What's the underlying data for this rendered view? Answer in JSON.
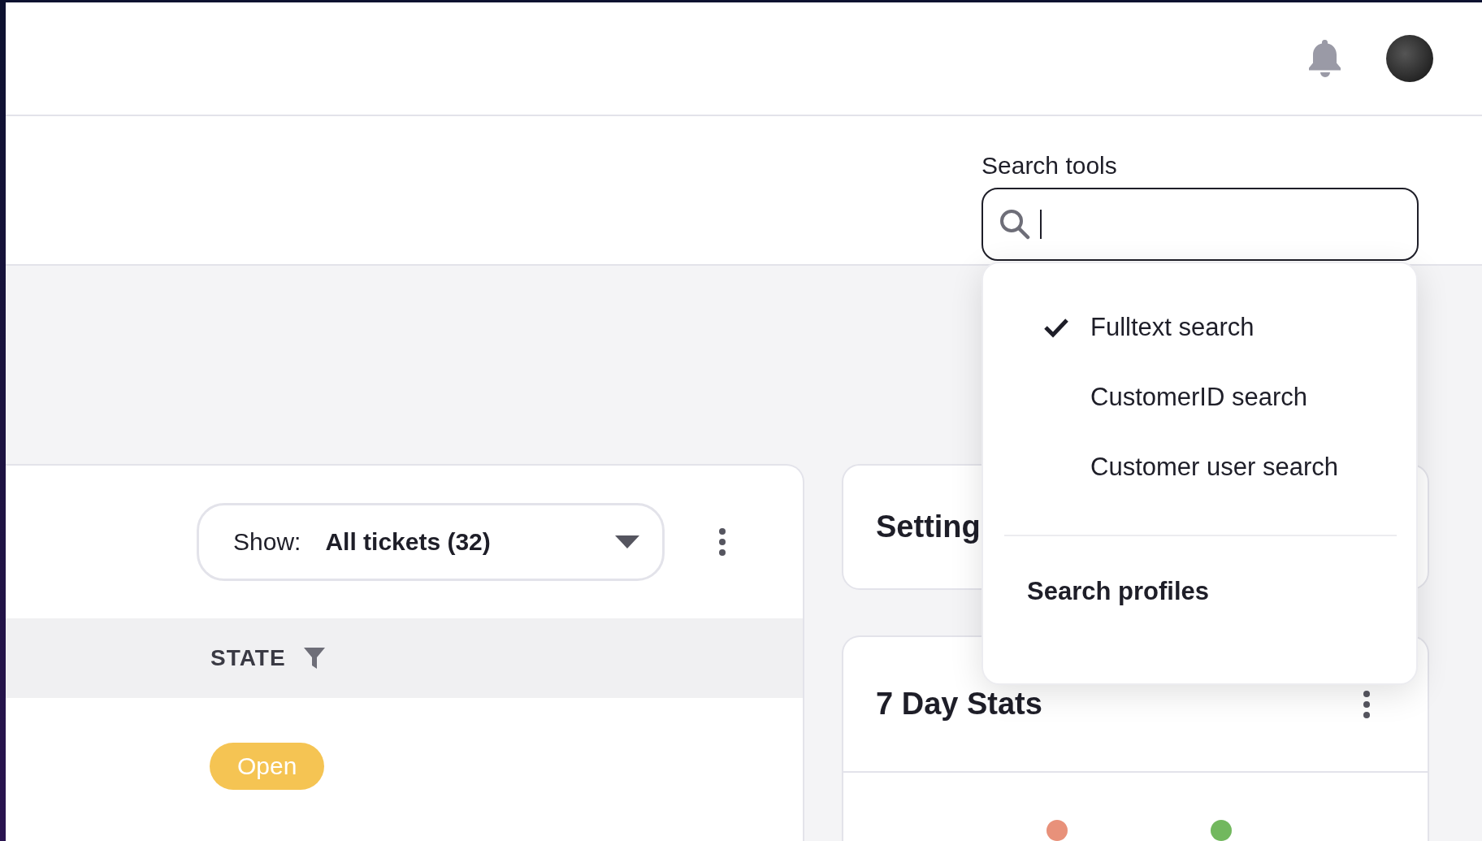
{
  "search": {
    "label": "Search tools",
    "menu": [
      {
        "label": "Fulltext search",
        "selected": true
      },
      {
        "label": "CustomerID search",
        "selected": false
      },
      {
        "label": "Customer user search",
        "selected": false
      }
    ],
    "profiles_label": "Search profiles"
  },
  "tickets": {
    "show_label": "Show:",
    "show_value": "All tickets (32)",
    "columns": [
      {
        "label": "STATE"
      }
    ],
    "rows": [
      {
        "state": "Open",
        "color": "#f5c453"
      }
    ]
  },
  "cards": [
    {
      "title": "Setting"
    },
    {
      "title": "7 Day Stats",
      "legend": [
        {
          "color": "#e8917a"
        },
        {
          "color": "#72b85e"
        }
      ]
    }
  ]
}
